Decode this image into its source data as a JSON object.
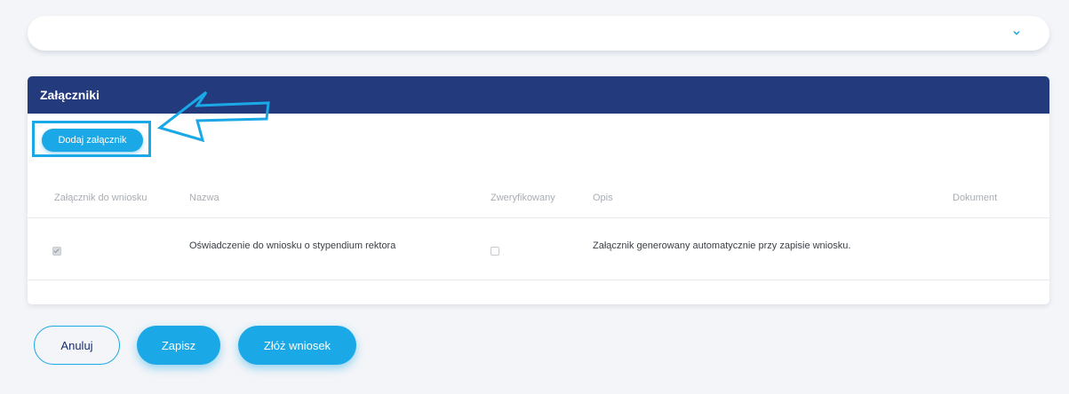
{
  "attachments": {
    "title": "Załączniki",
    "add_button": "Dodaj załącznik",
    "columns": {
      "attachment": "Załącznik do wniosku",
      "name": "Nazwa",
      "verified": "Zweryfikowany",
      "description": "Opis",
      "document": "Dokument"
    },
    "rows": [
      {
        "included": true,
        "name": "Oświadczenie do wniosku o stypendium rektora",
        "verified": false,
        "description": "Załącznik generowany automatycznie przy zapisie wniosku.",
        "document": ""
      }
    ]
  },
  "actions": {
    "cancel": "Anuluj",
    "save": "Zapisz",
    "submit": "Złóż wniosek"
  },
  "colors": {
    "accent": "#1aa8e6",
    "header": "#233a7c",
    "annotation": "#1aa8e6"
  },
  "icons": {
    "collapsed_section": "chevron-down-icon",
    "annotation": "arrow-left-icon"
  }
}
